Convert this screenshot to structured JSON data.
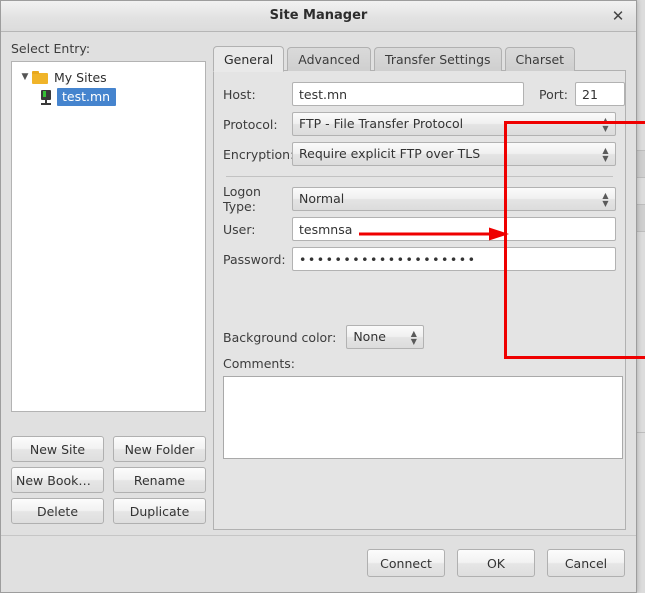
{
  "window": {
    "title": "Site Manager",
    "close_icon": "close-icon",
    "close_glyph": "✕"
  },
  "left": {
    "select_entry_label": "Select Entry:",
    "tree": {
      "root": {
        "label": "My Sites",
        "twisty_glyph": "▼",
        "expanded": true
      },
      "children": [
        {
          "label": "test.mn",
          "selected": true
        }
      ]
    },
    "buttons": [
      {
        "label": "New Site"
      },
      {
        "label": "New Folder"
      },
      {
        "label": "New Bookmark"
      },
      {
        "label": "Rename"
      },
      {
        "label": "Delete"
      },
      {
        "label": "Duplicate"
      }
    ]
  },
  "tabs": [
    {
      "label": "General",
      "active": true
    },
    {
      "label": "Advanced",
      "active": false
    },
    {
      "label": "Transfer Settings",
      "active": false
    },
    {
      "label": "Charset",
      "active": false
    }
  ],
  "general": {
    "host_label": "Host:",
    "host_value": "test.mn",
    "port_label": "Port:",
    "port_value": "21",
    "protocol_label": "Protocol:",
    "protocol_value": "FTP - File Transfer Protocol",
    "encryption_label": "Encryption:",
    "encryption_value": "Require explicit FTP over TLS",
    "logon_type_label": "Logon Type:",
    "logon_type_value": "Normal",
    "user_label": "User:",
    "user_value": "tesmnsa",
    "password_label": "Password:",
    "password_value": "••••••••••••••••••••",
    "background_color_label": "Background color:",
    "background_color_value": "None",
    "comments_label": "Comments:",
    "comments_value": "",
    "spin_up_glyph": "▲",
    "spin_down_glyph": "▼"
  },
  "footer": {
    "buttons": [
      {
        "label": "Connect"
      },
      {
        "label": "OK"
      },
      {
        "label": "Cancel"
      }
    ]
  },
  "annotations": {
    "highlight_color": "#ef0000",
    "arrow_color": "#ef0000",
    "highlight_target": "credentials-and-connection-fields",
    "arrow_points_to": "encryption-row"
  },
  "colors": {
    "selection_blue": "#4584ce",
    "dialog_bg": "#e0e0e0",
    "panel_bg": "#e4e4e4",
    "folder_yellow": "#f0b429"
  }
}
